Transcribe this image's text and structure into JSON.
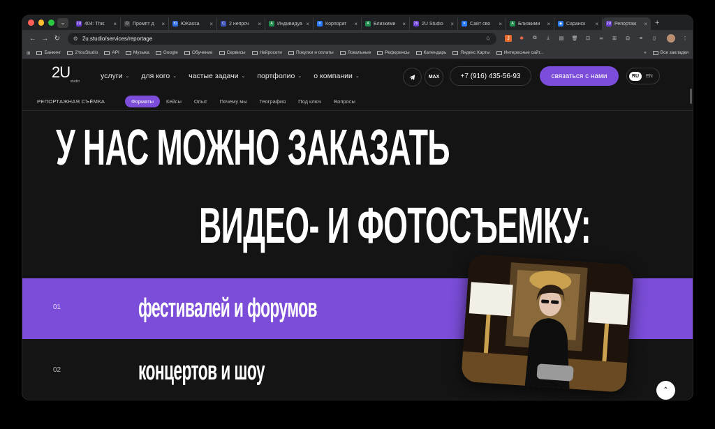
{
  "tabs": [
    {
      "title": "404: This",
      "favicon": "2U",
      "color": "#6b3fd1"
    },
    {
      "title": "Промпт д",
      "favicon": "O",
      "color": "#444444"
    },
    {
      "title": "ЮKassa",
      "favicon": "Ю",
      "color": "#2d6cdf"
    },
    {
      "title": "2 непроч",
      "favicon": "C",
      "color": "#3f51b5"
    },
    {
      "title": "Индивидуа",
      "favicon": "A",
      "color": "#1f8a4c"
    },
    {
      "title": "Корпорат",
      "favicon": "✕",
      "color": "#2979ff"
    },
    {
      "title": "Близкими",
      "favicon": "A",
      "color": "#1f8a4c"
    },
    {
      "title": "2U Studio",
      "favicon": "2U",
      "color": "#6b3fd1"
    },
    {
      "title": "Сайт сво",
      "favicon": "✕",
      "color": "#2979ff"
    },
    {
      "title": "Близкими",
      "favicon": "A",
      "color": "#1f8a4c"
    },
    {
      "title": "Саранск",
      "favicon": "◆",
      "color": "#2b7de9"
    },
    {
      "title": "Репортаж",
      "favicon": "2U",
      "color": "#6b3fd1",
      "active": true
    }
  ],
  "browser": {
    "url": "2u.studio/services/reportage"
  },
  "bookmarks": [
    "Банкинг",
    "2YouStudio",
    "API",
    "Музыка",
    "Google",
    "Обучение",
    "Сервисы",
    "Нейросети",
    "Покупки и оплаты",
    "Локальные",
    "Референсы",
    "Календарь",
    "Яндекс Карты",
    "Интересные сайт..."
  ],
  "bookmarks_all": "Все закладки",
  "site": {
    "logo": "2U",
    "logo_sub": "studio",
    "nav": [
      "услуги",
      "для кого",
      "частые задачи",
      "портфолио",
      "о компании"
    ],
    "max_label": "MAX",
    "phone": "+7 (916) 435-56-93",
    "contact": "связаться с нами",
    "lang_active": "RU",
    "lang_other": "EN"
  },
  "subnav": {
    "title": "РЕПОРТАЖНАЯ СЪЁМКА",
    "items": [
      "Форматы",
      "Кейсы",
      "Опыт",
      "Почему мы",
      "География",
      "Под ключ",
      "Вопросы"
    ]
  },
  "hero": {
    "line1": "У НАС МОЖНО ЗАКАЗАТЬ",
    "line2": "ВИДЕО- И ФОТОСЪЕМКУ:"
  },
  "formats": [
    {
      "num": "01",
      "label": "фестивалей и форумов"
    },
    {
      "num": "02",
      "label": "концертов и шоу"
    }
  ],
  "colors": {
    "accent": "#7c4ddb",
    "background": "#141414"
  }
}
